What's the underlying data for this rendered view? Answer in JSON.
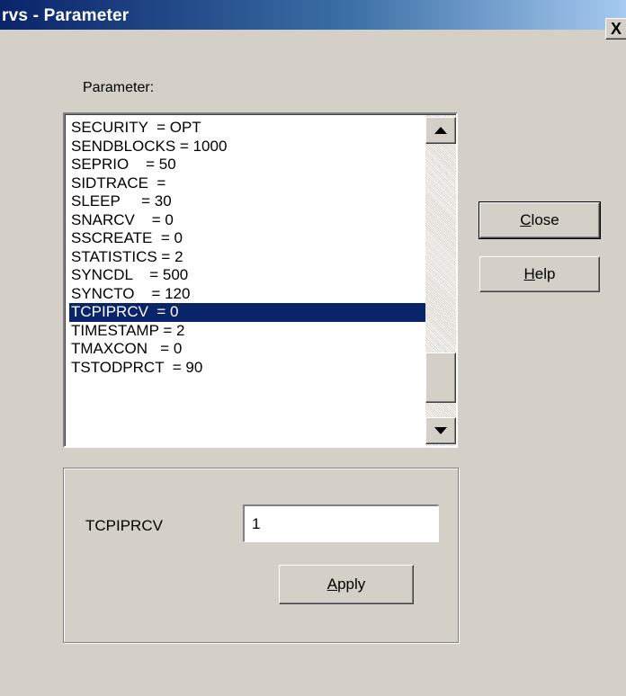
{
  "window": {
    "title": "rvs - Parameter",
    "close_glyph": "X"
  },
  "parameter_list": {
    "label": "Parameter:",
    "items": [
      "SECURITY  = OPT",
      "SENDBLOCKS = 1000",
      "SEPRIO    = 50",
      "SIDTRACE  = ",
      "SLEEP     = 30",
      "SNARCV    = 0",
      "SSCREATE  = 0",
      "STATISTICS = 2",
      "SYNCDL    = 500",
      "SYNCTO    = 120",
      "TCPIPRCV  = 0",
      "TIMESTAMP = 2",
      "TMAXCON   = 0",
      "TSTODPRCT  = 90"
    ],
    "selected_index": 10,
    "scroll_up_icon": "scroll-up-arrow",
    "scroll_down_icon": "scroll-down-arrow"
  },
  "edit": {
    "label": "TCPIPRCV",
    "value": "1",
    "apply_mnemonic": "A",
    "apply_rest": "pply"
  },
  "buttons": {
    "close_mnemonic": "C",
    "close_rest": "lose",
    "help_mnemonic": "H",
    "help_rest": "elp"
  },
  "colors": {
    "dialog_bg": "#d4d0c8",
    "titlebar_start": "#0a246a",
    "selection": "#0a246a"
  }
}
